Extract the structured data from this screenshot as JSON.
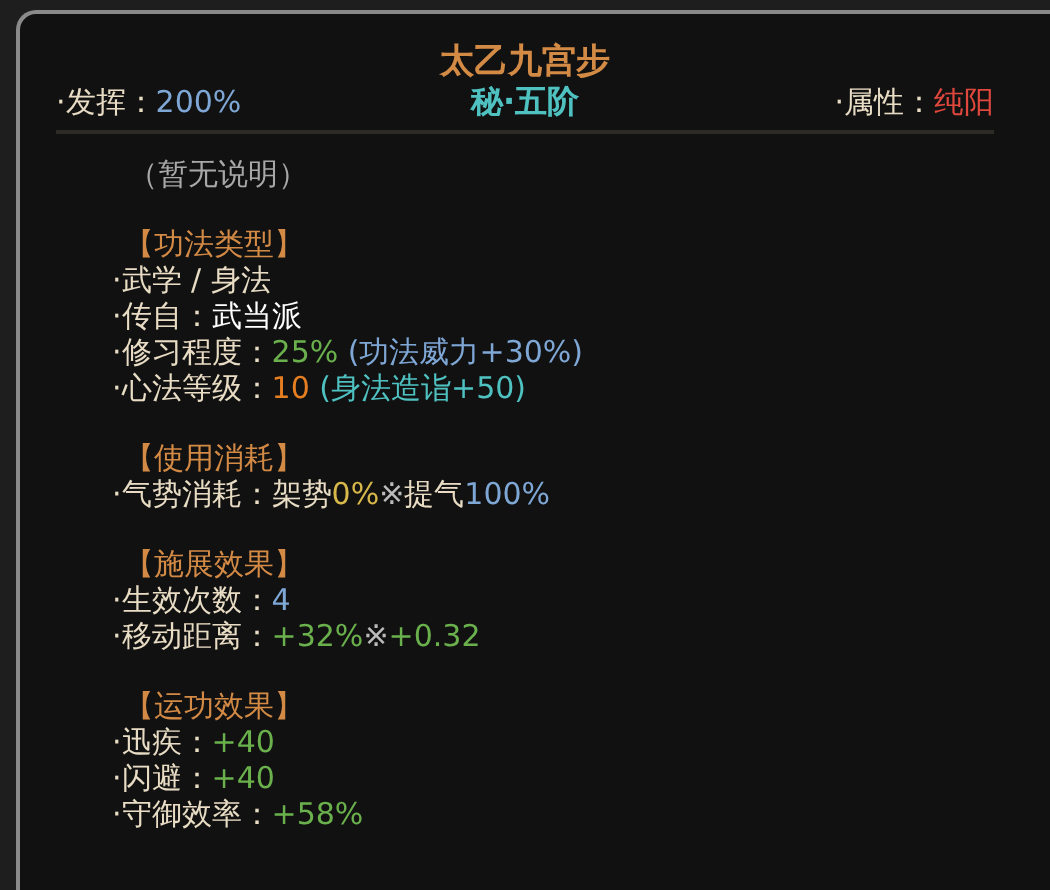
{
  "title": "太乙九宫步",
  "rank": "秘·五阶",
  "left_stat": {
    "label": "·发挥：",
    "value": "200%"
  },
  "right_stat": {
    "label": "·属性：",
    "value": "纯阳"
  },
  "description": "（暂无说明）",
  "sections": [
    {
      "heading": "【功法类型】",
      "lines": [
        [
          {
            "text": "·武学 / 身法",
            "color": "#e8dcc4"
          }
        ],
        [
          {
            "text": "·传自：",
            "color": "#e8dcc4"
          },
          {
            "text": "武当派",
            "color": "#ffffff"
          }
        ],
        [
          {
            "text": "·修习程度：",
            "color": "#e8dcc4"
          },
          {
            "text": "25%",
            "color": "#6ab04c"
          },
          {
            "text": " (功法威力+30%)",
            "color": "#7fa7d6"
          }
        ],
        [
          {
            "text": "·心法等级：",
            "color": "#e8dcc4"
          },
          {
            "text": "10",
            "color": "#e67e22"
          },
          {
            "text": " (身法造诣+50)",
            "color": "#4fc1c1"
          }
        ]
      ]
    },
    {
      "heading": "【使用消耗】",
      "lines": [
        [
          {
            "text": "·气势消耗：",
            "color": "#e8dcc4"
          },
          {
            "text": "架势",
            "color": "#e8dcc4"
          },
          {
            "text": "0%",
            "color": "#d8b84a"
          },
          {
            "text": "※",
            "color": "#bbbbbb"
          },
          {
            "text": "提气",
            "color": "#e8dcc4"
          },
          {
            "text": "100%",
            "color": "#7fa7d6"
          }
        ]
      ]
    },
    {
      "heading": "【施展效果】",
      "lines": [
        [
          {
            "text": "·生效次数：",
            "color": "#e8dcc4"
          },
          {
            "text": "4",
            "color": "#7fa7d6"
          }
        ],
        [
          {
            "text": "·移动距离：",
            "color": "#e8dcc4"
          },
          {
            "text": "+32%",
            "color": "#6ab04c"
          },
          {
            "text": "※",
            "color": "#bbbbbb"
          },
          {
            "text": "+0.32",
            "color": "#6ab04c"
          }
        ]
      ]
    },
    {
      "heading": "【运功效果】",
      "lines": [
        [
          {
            "text": "·迅疾：",
            "color": "#e8dcc4"
          },
          {
            "text": "+40",
            "color": "#6ab04c"
          }
        ],
        [
          {
            "text": "·闪避：",
            "color": "#e8dcc4"
          },
          {
            "text": "+40",
            "color": "#6ab04c"
          }
        ],
        [
          {
            "text": "·守御效率：",
            "color": "#e8dcc4"
          },
          {
            "text": "+58%",
            "color": "#6ab04c"
          }
        ]
      ]
    }
  ]
}
